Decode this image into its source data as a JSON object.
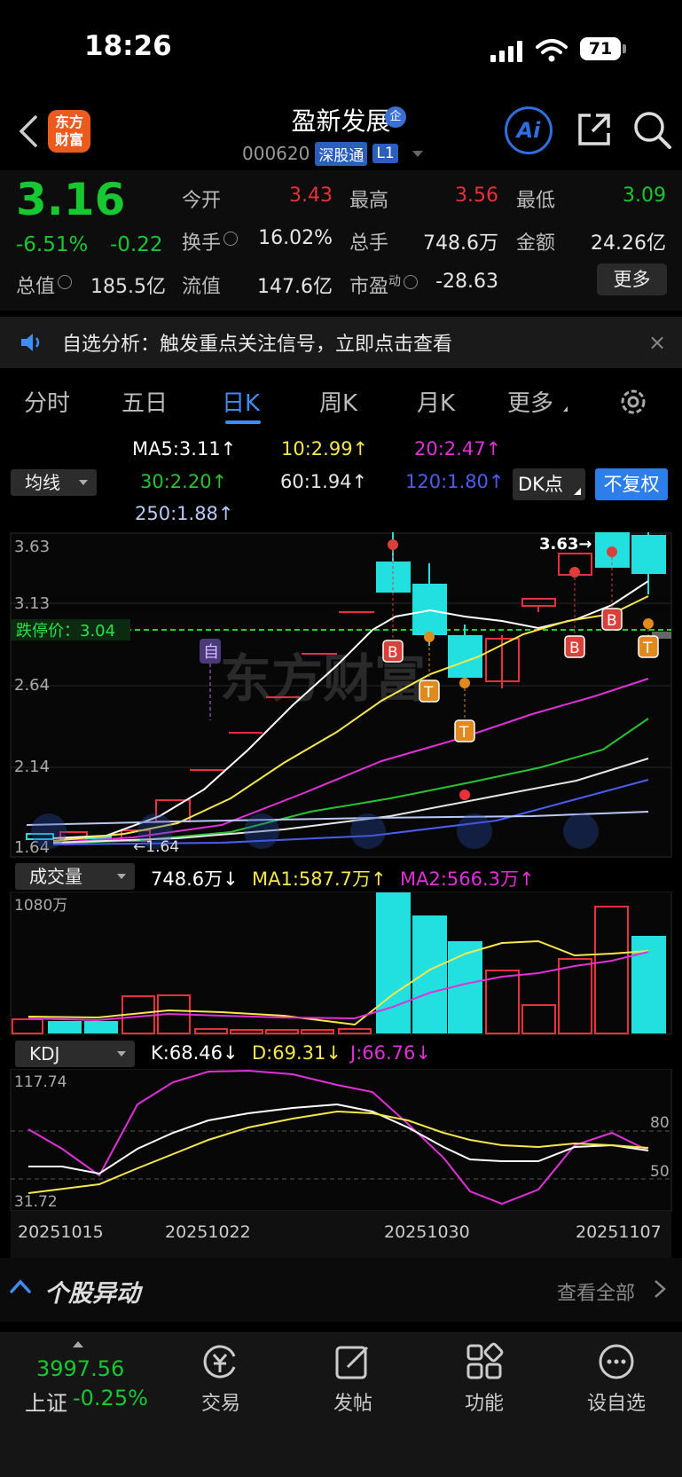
{
  "status_bar": {
    "time": "18:26",
    "battery": "71"
  },
  "header": {
    "logo": [
      "东方",
      "财富"
    ],
    "stock_name": "盈新发展",
    "enterprise_badge": "企",
    "code": "000620",
    "tags": [
      "深股通",
      "L1"
    ],
    "ai_label": "Ai"
  },
  "quote": {
    "price": "3.16",
    "change_pct": "-6.51%",
    "change_amt": "-0.22",
    "rows": [
      [
        {
          "label": "今开",
          "value": "3.43",
          "color": "red"
        },
        {
          "label": "最高",
          "value": "3.56",
          "color": "red"
        },
        {
          "label": "最低",
          "value": "3.09",
          "color": "green"
        }
      ],
      [
        {
          "label": "换手",
          "value": "16.02%",
          "color": "white"
        },
        {
          "label": "总手",
          "value": "748.6万",
          "color": "white"
        },
        {
          "label": "金额",
          "value": "24.26亿",
          "color": "white"
        }
      ]
    ],
    "mcap_label": "总值",
    "mcap_value": "185.5亿",
    "float_label": "流值",
    "float_value": "147.6亿",
    "pe_label": "市盈",
    "pe_super": "动",
    "pe_value": "-28.63",
    "more_label": "更多"
  },
  "banner": {
    "text": "自选分析：触发重点关注信号，立即点击查看",
    "close": "×"
  },
  "tabs": {
    "items": [
      "分时",
      "五日",
      "日K",
      "周K",
      "月K",
      "更多"
    ],
    "active": "日K"
  },
  "ma_row": {
    "select_label": "均线",
    "items": [
      {
        "text": "MA5:3.11↑",
        "color": "#ffffff"
      },
      {
        "text": "10:2.99↑",
        "color": "#f5e74a"
      },
      {
        "text": "20:2.47↑",
        "color": "#e030d8"
      },
      {
        "text": "30:2.20↑",
        "color": "#27c42f"
      },
      {
        "text": "60:1.94↑",
        "color": "#e6e6e6"
      },
      {
        "text": "120:1.80↑",
        "color": "#4a5df0"
      },
      {
        "text": "250:1.88↑",
        "color": "#b9c9f5"
      }
    ],
    "dk_label": "DK点",
    "fq_label": "不复权"
  },
  "kline": {
    "y_labels": [
      "3.63",
      "3.13",
      "2.64",
      "2.14",
      "1.64"
    ],
    "limit_down_label": "跌停价：3.04",
    "high_marker": "3.63",
    "low_marker": "1.64",
    "self_marker": "自",
    "watermark": "东方财富",
    "signals": [
      "B",
      "T",
      "T",
      "B",
      "B",
      "T"
    ]
  },
  "volume": {
    "select_label": "成交量",
    "value": "748.6万↓",
    "ma1": "MA1:587.7万↑",
    "ma2": "MA2:566.3万↑",
    "y_max": "1080万"
  },
  "kdj": {
    "select_label": "KDJ",
    "k": "K:68.46↓",
    "d": "D:69.31↓",
    "j": "J:66.76↓",
    "y_max": "117.74",
    "y_min": "31.72",
    "level_80": "80",
    "level_50": "50"
  },
  "dates": [
    "20251015",
    "20251022",
    "20251030",
    "20251107"
  ],
  "movement": {
    "title": "个股异动",
    "view_all": "查看全部"
  },
  "bottom_nav": {
    "index_value": "3997.56",
    "index_name": "上证",
    "index_change": "-0.25%",
    "items": [
      "交易",
      "发帖",
      "功能",
      "设自选"
    ]
  },
  "colors": {
    "up": "#e8313a",
    "down": "#16c931",
    "cyan": "#22e0e0",
    "accent": "#3f8cf2"
  }
}
